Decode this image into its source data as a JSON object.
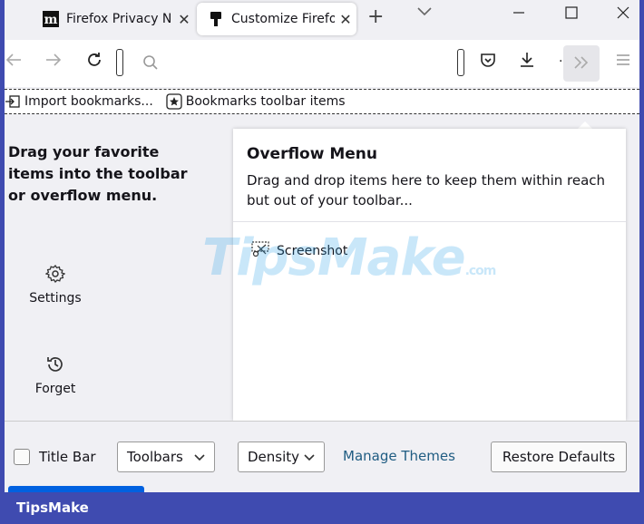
{
  "tabs": [
    {
      "title": "Firefox Privacy N",
      "favicon": "m",
      "active": false
    },
    {
      "title": "Customize Firefo",
      "favicon": "brush-icon",
      "active": true
    }
  ],
  "bookmarks": [
    {
      "label": "Import bookmarks...",
      "icon": "import-icon"
    },
    {
      "label": "Bookmarks toolbar items",
      "icon": "star-icon"
    }
  ],
  "customize": {
    "intro": "Drag your favorite items into the toolbar or overflow menu.",
    "palette": [
      {
        "label": "Settings",
        "icon": "gear-icon"
      },
      {
        "label": "Forget",
        "icon": "history-icon"
      }
    ]
  },
  "overflow_menu": {
    "title": "Overflow Menu",
    "description": "Drag and drop items here to keep them within reach but out of your toolbar...",
    "items": [
      {
        "label": "Screenshot",
        "icon": "screenshot-icon"
      }
    ]
  },
  "watermark": {
    "main": "TipsMake",
    "suffix": ".com"
  },
  "footer": {
    "title_bar_label": "Title Bar",
    "title_bar_checked": false,
    "toolbars_label": "Toolbars",
    "density_label": "Density",
    "manage_themes": "Manage Themes",
    "restore_defaults": "Restore Defaults"
  },
  "brand": "TipsMake",
  "colors": {
    "accent": "#0061e0",
    "frame": "#3f4bb0",
    "link": "#1f5c82"
  }
}
